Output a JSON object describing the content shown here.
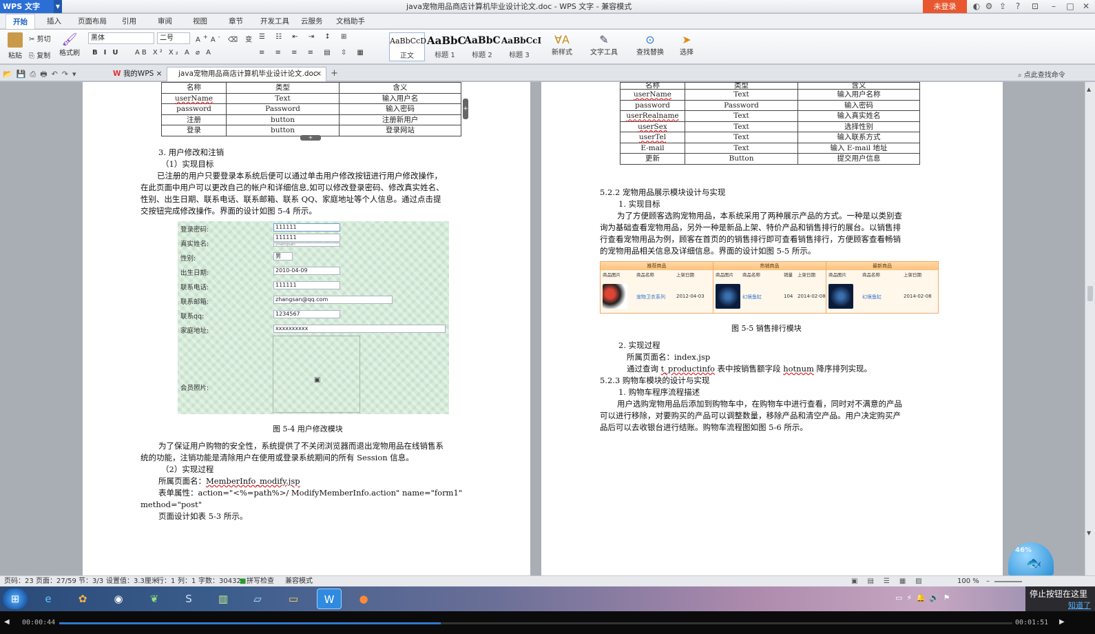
{
  "app": {
    "name": "WPS 文字",
    "title": "java宠物用品商店计算机毕业设计论文.doc - WPS 文字 - 兼容模式",
    "login": "未登录"
  },
  "menu": [
    "开始",
    "插入",
    "页面布局",
    "引用",
    "审阅",
    "视图",
    "章节",
    "开发工具",
    "云服务",
    "文档助手"
  ],
  "ribbon": {
    "paste": "粘贴",
    "cut": "剪切",
    "copy": "复制",
    "format_painter": "格式刷",
    "font": "黑体",
    "size": "二号",
    "styles": [
      {
        "sample": "AaBbCcD",
        "name": "正文"
      },
      {
        "sample": "AaBbC",
        "name": "标题 1"
      },
      {
        "sample": "AaBbC",
        "name": "标题 2"
      },
      {
        "sample": "AaBbCcI",
        "name": "标题 3"
      }
    ],
    "new_style": "新样式",
    "text_tools": "文字工具",
    "find_replace": "查找替换",
    "select": "选择"
  },
  "tabs": {
    "mywps": "我的WPS",
    "doc": "java宠物用品商店计算机毕业设计论文.doc",
    "search": "点此查找命令"
  },
  "page1": {
    "table_header": [
      "名称",
      "类型",
      "含义"
    ],
    "table_rows": [
      [
        "userName",
        "Text",
        "输入用户名"
      ],
      [
        "password",
        "Password",
        "输入密码"
      ],
      [
        "注册",
        "button",
        "注册新用户"
      ],
      [
        "登录",
        "button",
        "登录网站"
      ]
    ],
    "h3": "3. 用户修改和注销",
    "h_target": "（1）实现目标",
    "para1_lines": [
      "已注册的用户只要登录本系统后便可以通过单击用户修改按钮进行用户修改操作，",
      "在此页面中用户可以更改自己的帐户和详细信息,如可以修改登录密码、修改真实姓名、",
      "性别、出生日期、联系电话、联系邮箱、联系 QQ、家庭地址等个人信息。通过点击提",
      "交按钮完成修改操作。界面的设计如图 5-4 所示。"
    ],
    "form": [
      {
        "label": "登录密码:",
        "value": "111111"
      },
      {
        "label": "",
        "value": "111111"
      },
      {
        "label": "真实姓名:",
        "value": "zhangsan"
      },
      {
        "label": "性别:",
        "value": "男"
      },
      {
        "label": "出生日期:",
        "value": "2010-04-09"
      },
      {
        "label": "联系电话:",
        "value": "111111"
      },
      {
        "label": "联系邮箱:",
        "value": "zhangsan@qq.com"
      },
      {
        "label": "联系qq:",
        "value": "1234567"
      },
      {
        "label": "家庭地址:",
        "value": "xxxxxxxxxx"
      },
      {
        "label": "会员照片:",
        "value": ""
      }
    ],
    "fig_caption": "图 5-4   用户修改模块",
    "para2_lines": [
      "为了保证用户购物的安全性，系统提供了不关闭浏览器而退出宠物用品在线销售系",
      "统的功能，注销功能是清除用户在使用或登录系统期间的所有 Session 信息。"
    ],
    "h_process": "（2）实现过程",
    "page_name_label": "所属页面名：",
    "page_name": "MemberInfo_modify.jsp",
    "form_attr_label": "表单属性：",
    "form_attr": "action=\"<%=path%>/ ModifyMemberInfo.action\" name=\"form1\"",
    "form_method": "method=\"post\"",
    "page_design": "页面设计如表 5-3 所示。"
  },
  "page2": {
    "table_header": [
      "名称",
      "类型",
      "含义"
    ],
    "table_rows": [
      [
        "userName",
        "Text",
        "输入用户名称"
      ],
      [
        "password",
        "Password",
        "输入密码"
      ],
      [
        "userRealname",
        "Text",
        "输入真实姓名"
      ],
      [
        "userSex",
        "Text",
        "选择性别"
      ],
      [
        "userTel",
        "Text",
        "输入联系方式"
      ],
      [
        "E-mail",
        "Text",
        "输入 E-mail 地址"
      ],
      [
        "更新",
        "Button",
        "提交用户信息"
      ]
    ],
    "h522": "5.2.2   宠物用品展示模块设计与实现",
    "h_target": "1. 实现目标",
    "para1_lines": [
      "为了方便顾客选购宠物用品，本系统采用了两种展示产品的方式。一种是以类别查",
      "询为基础查看宠物用品，另外一种是新品上架、特价产品和销售排行的展台。以销售排",
      "行查看宠物用品为例，顾客在首页的的销售排行即可查看销售排行，方便顾客查看畅销",
      "的宠物用品相关信息及详细信息。界面的设计如图 5-5 所示。"
    ],
    "fig": {
      "cols": [
        {
          "title": "推荐商品",
          "heads": [
            "商品图片",
            "商品名称",
            "上架日期"
          ],
          "name": "宠物卫衣系列",
          "sales": "",
          "date": "2012-04-03"
        },
        {
          "title": "热销商品",
          "heads": [
            "商品图片",
            "商品名称",
            "销量",
            "上架日期"
          ],
          "name": "幻境鱼缸",
          "sales": "104",
          "date": "2014-02-08"
        },
        {
          "title": "最新商品",
          "heads": [
            "商品图片",
            "商品名称",
            "上架日期"
          ],
          "name": "幻境鱼缸",
          "sales": "",
          "date": "2014-02-08"
        }
      ]
    },
    "fig_caption": "图 5-5   销售排行模块",
    "h_process": "2. 实现过程",
    "page_name_label": "所属页面名：",
    "page_name": "index.jsp",
    "query_pre": "通过查询 ",
    "query_table": "t_productinfo",
    "query_mid": " 表中按销售额字段 ",
    "query_field": "hotnum",
    "query_post": " 降序排列实现。",
    "h523": "5.2.3   购物车模块的设计与实现",
    "h_flow": "1. 购物车程序流程描述",
    "para2_lines": [
      "用户选购宠物用品后添加到购物车中，在购物车中进行查看，同时对不满意的产品",
      "可以进行移除，对要购买的产品可以调整数量，移除产品和清空产品。用户决定购买产",
      "品后可以去收银台进行结账。购物车流程图如图 5-6 所示。"
    ]
  },
  "status": {
    "page_no": "页码：23",
    "page": "页面：27/59",
    "section": "节：3/3",
    "setting": "设置值：3.3厘米",
    "row": "行：1",
    "col": "列：1",
    "words": "字数：30432",
    "spell": "拼写检查",
    "compat": "兼容模式",
    "zoom": "100 %"
  },
  "overlay": {
    "percent": "46%",
    "notice": "停止按钮在这里",
    "ok": "知道了"
  },
  "player": {
    "elapsed": "00:00:44",
    "total": "00:01:51",
    "progress": 0.4
  }
}
